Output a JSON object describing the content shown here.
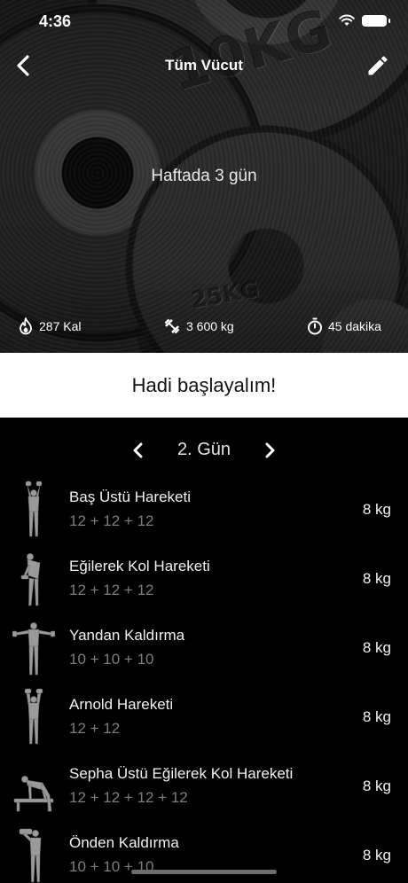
{
  "status_bar": {
    "time": "4:36"
  },
  "nav": {
    "title": "Tüm Vücut"
  },
  "hero": {
    "plate_labels": [
      "10KG",
      "25KG"
    ],
    "frequency": "Haftada 3 gün",
    "stats": {
      "calories": "287 Kal",
      "volume": "3 600 kg",
      "duration": "45 dakika"
    }
  },
  "start_button": "Hadi başlayalım!",
  "day_selector": {
    "label": "2. Gün"
  },
  "exercises": [
    {
      "name": "Baş Üstü Hareketi",
      "reps": "12 + 12 + 12",
      "weight": "8 kg"
    },
    {
      "name": "Eğilerek Kol Hareketi",
      "reps": "12 + 12 + 12",
      "weight": "8 kg"
    },
    {
      "name": "Yandan Kaldırma",
      "reps": "10 + 10 + 10",
      "weight": "8 kg"
    },
    {
      "name": "Arnold Hareketi",
      "reps": "12 + 12",
      "weight": "8 kg"
    },
    {
      "name": "Sepha Üstü Eğilerek Kol Hareketi",
      "reps": "12 + 12 + 12 + 12",
      "weight": "8 kg"
    },
    {
      "name": "Önden Kaldırma",
      "reps": "10 + 10 + 10",
      "weight": "8 kg"
    }
  ]
}
